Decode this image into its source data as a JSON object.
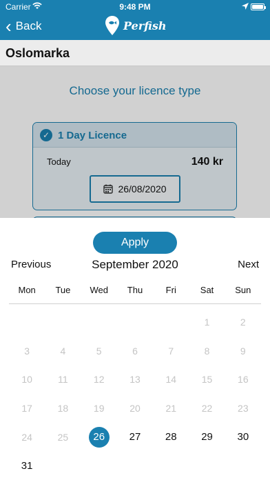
{
  "status_bar": {
    "carrier": "Carrier",
    "time": "9:48 PM"
  },
  "nav": {
    "back_label": "Back",
    "brand": "Perfish"
  },
  "page": {
    "title": "Oslomarka",
    "prompt": "Choose your licence type"
  },
  "licence": {
    "title": "1 Day Licence",
    "day_label": "Today",
    "price": "140 kr",
    "date": "26/08/2020"
  },
  "calendar": {
    "apply_label": "Apply",
    "prev_label": "Previous",
    "next_label": "Next",
    "month_label": "September 2020",
    "weekdays": [
      "Mon",
      "Tue",
      "Wed",
      "Thu",
      "Fri",
      "Sat",
      "Sun"
    ],
    "weeks": [
      [
        "",
        "",
        "",
        "",
        "",
        "1",
        "2"
      ],
      [
        "3",
        "4",
        "5",
        "6",
        "7",
        "8",
        "9"
      ],
      [
        "10",
        "11",
        "12",
        "13",
        "14",
        "15",
        "16"
      ],
      [
        "17",
        "18",
        "19",
        "20",
        "21",
        "22",
        "23"
      ],
      [
        "24",
        "25",
        "26",
        "27",
        "28",
        "29",
        "30"
      ],
      [
        "31",
        "",
        "",
        "",
        "",
        "",
        ""
      ]
    ],
    "selected_day": "26",
    "first_enabled_day": 26
  },
  "colors": {
    "accent": "#1a80b0",
    "disabled_text": "#c4c4c4"
  },
  "icons": [
    "wifi-icon",
    "location-icon",
    "battery-icon",
    "chevron-left-icon",
    "fish-pin-icon",
    "check-icon",
    "calendar-icon"
  ]
}
